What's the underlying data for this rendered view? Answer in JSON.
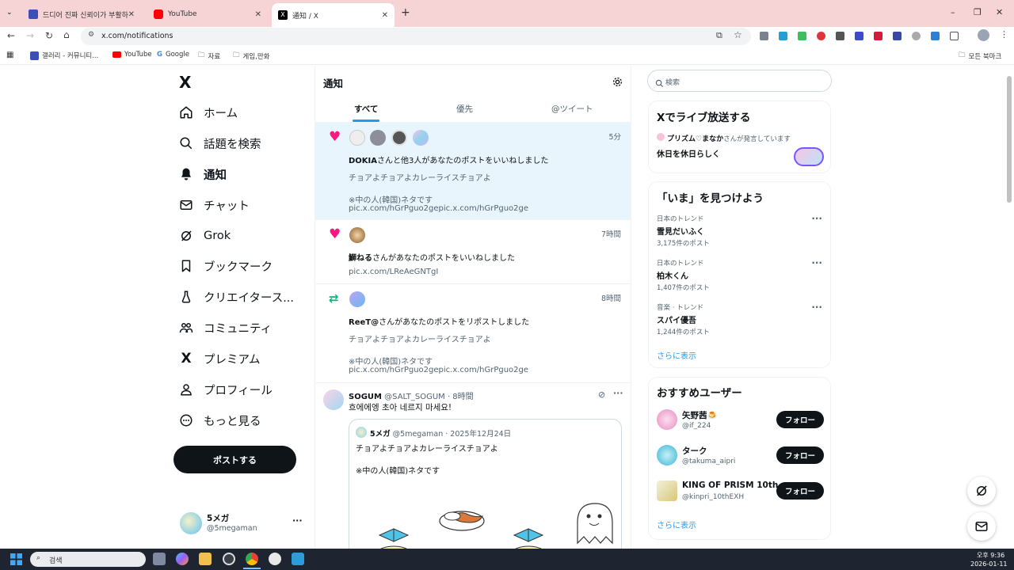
{
  "browser": {
    "tabs": [
      {
        "title": "드디어 진짜 신뢰이가 부활하다"
      },
      {
        "title": "YouTube"
      },
      {
        "title": "通知 / X"
      }
    ],
    "new_tab": "+",
    "url": "x.com/notifications",
    "bookmarks": [
      "갤러리 - 커뮤니티...",
      "YouTube",
      "Google",
      "자료",
      "게임,만화"
    ],
    "all_bookmarks": "모든 북마크",
    "window_controls": [
      "–",
      "❐",
      "✕"
    ]
  },
  "sidebar": {
    "logo": "X",
    "items": [
      {
        "label": "ホーム",
        "icon": "home-icon"
      },
      {
        "label": "話題を検索",
        "icon": "search-icon"
      },
      {
        "label": "通知",
        "icon": "bell-icon"
      },
      {
        "label": "チャット",
        "icon": "mail-icon"
      },
      {
        "label": "Grok",
        "icon": "grok-icon"
      },
      {
        "label": "ブックマーク",
        "icon": "bookmark-icon"
      },
      {
        "label": "クリエイタース...",
        "icon": "creator-icon"
      },
      {
        "label": "コミュニティ",
        "icon": "community-icon"
      },
      {
        "label": "プレミアム",
        "icon": "x-premium-icon"
      },
      {
        "label": "プロフィール",
        "icon": "person-icon"
      },
      {
        "label": "もっと見る",
        "icon": "more-circle-icon"
      }
    ],
    "post_button": "ポストする",
    "account": {
      "name": "5メガ",
      "handle": "@5megaman",
      "more": "···"
    }
  },
  "main": {
    "title": "通知",
    "tabs": [
      "すべて",
      "優先",
      "@ツイート"
    ],
    "notifications": [
      {
        "time": "5分",
        "actor": "DOKIA",
        "text": "さんと他3人があなたのポストをいいねしました",
        "line1": "チョアよチョアよカレーライスチョアよ",
        "line2": "※中の人(韓国)ネタです",
        "line3": "pic.x.com/hGrPguo2gepic.x.com/hGrPguo2ge"
      },
      {
        "time": "7時間",
        "actor": "鰤ねる",
        "text": "さんがあなたのポストをいいねしました",
        "line1": "pic.x.com/LReAeGNTgI"
      },
      {
        "time": "8時間",
        "actor": "ReeT@",
        "text": "さんがあなたのポストをリポストしました",
        "line1": "チョアよチョアよカレーライスチョアよ",
        "line2": "※中の人(韓国)ネタです",
        "line3": "pic.x.com/hGrPguo2gepic.x.com/hGrPguo2ge"
      }
    ],
    "reply": {
      "name": "SOGUM",
      "handle": "@SALT_SOGUM",
      "time": "· 8時間",
      "text": "흐에에엥 초아 네르지 마세요!",
      "quote": {
        "name": "5メガ",
        "handle": "@5megaman · 2025年12月24日",
        "line1": "チョアよチョアよカレーライスチョアよ",
        "line2": "※中の人(韓国)ネタです"
      }
    }
  },
  "right": {
    "search_placeholder": "検索",
    "live": {
      "title": "Xでライブ放送する",
      "host": "プリズム♡まなか",
      "host_suffix": "さんが発言しています",
      "topic": "休日を休日らしく"
    },
    "trends": {
      "title": "「いま」を見つけよう",
      "items": [
        {
          "context": "日本のトレンド",
          "name": "雪見だいふく",
          "count": "3,175件のポスト"
        },
        {
          "context": "日本のトレンド",
          "name": "柏木くん",
          "count": "1,407件のポスト"
        },
        {
          "context": "音楽 · トレンド",
          "name": "スパイ優吾",
          "count": "1,244件のポスト"
        }
      ],
      "more": "さらに表示"
    },
    "who_to_follow": {
      "title": "おすすめユーザー",
      "users": [
        {
          "name": "矢野茜🍮",
          "handle": "@if_224"
        },
        {
          "name": "ターク",
          "handle": "@takuma_aipri"
        },
        {
          "name": "KING OF PRISM 10th ...",
          "handle": "@kinpri_10thEXH"
        }
      ],
      "follow_label": "フォロー",
      "more": "さらに表示"
    }
  },
  "taskbar": {
    "search": "검색",
    "time": "오후 9:36",
    "date": "2026-01-11"
  }
}
